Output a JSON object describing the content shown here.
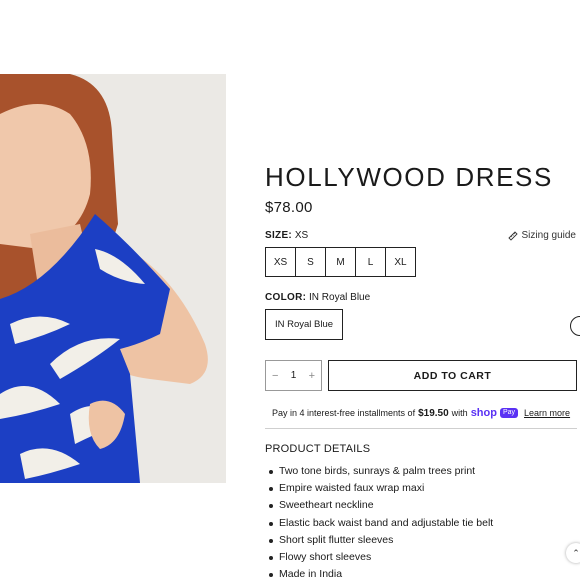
{
  "product": {
    "title": "HOLLYWOOD DRESS",
    "price": "$78.00"
  },
  "size": {
    "label": "SIZE:",
    "selected": "XS",
    "guide_label": "Sizing guide",
    "options": [
      "XS",
      "S",
      "M",
      "L",
      "XL"
    ]
  },
  "color": {
    "label": "COLOR:",
    "selected": "IN Royal Blue",
    "option": "IN Royal Blue"
  },
  "cart": {
    "qty_minus": "−",
    "quantity": "1",
    "qty_plus": "+",
    "add_label": "ADD TO CART"
  },
  "installments": {
    "text": "Pay in 4 interest-free installments of",
    "amount": "$19.50",
    "with": "with",
    "shop": "shop",
    "pay": "Pay",
    "learn_more": "Learn more"
  },
  "details": {
    "title": "PRODUCT DETAILS",
    "items": [
      "Two tone birds, sunrays & palm trees print",
      "Empire waisted faux wrap maxi",
      "Sweetheart neckline",
      "Elastic back waist band and adjustable tie belt",
      "Short split flutter sleeves",
      "Flowy short sleeves",
      "Made in India"
    ]
  },
  "icons": {
    "sizing": "ruler-icon",
    "scroll": "chevron-up-icon"
  },
  "colors": {
    "dress_blue": "#1c3fc4",
    "shop_pay": "#5a31f4"
  }
}
